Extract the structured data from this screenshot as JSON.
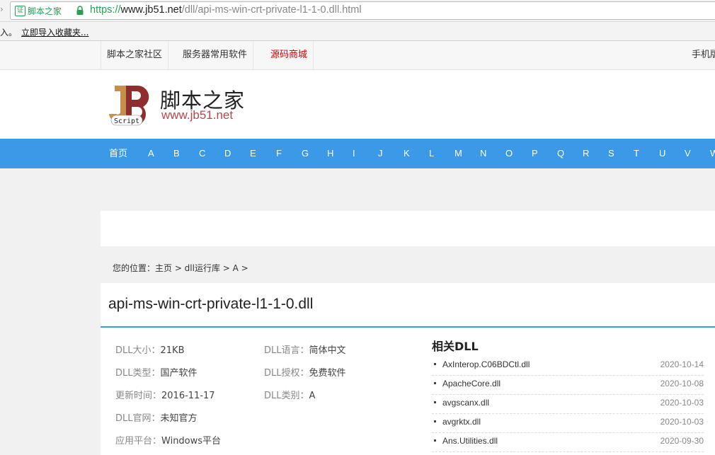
{
  "browser": {
    "cert_label": "脚本之家",
    "cert_icon_text": "证",
    "url_proto": "https://",
    "url_host": "www.jb51.net",
    "url_path": "/dll/api-ms-win-crt-private-l1-1-0.dll.html",
    "bookmarks_cut": "入。",
    "bookmarks_import": "立即导入收藏夹..."
  },
  "topnav": {
    "items": [
      "脚本之家社区",
      "服务器常用软件",
      "源码商城"
    ],
    "highlight_color": "#d40000",
    "right_cut": "手机版"
  },
  "logo": {
    "mark_letters": "JB",
    "mark_sub": "Script",
    "name": "脚本之家",
    "url": "www.jb51.net"
  },
  "alphabar": {
    "color": "#3b99e8",
    "home": "首页",
    "letters": [
      "A",
      "B",
      "C",
      "D",
      "E",
      "F",
      "G",
      "H",
      "I",
      "J",
      "K",
      "L",
      "M",
      "N",
      "O",
      "P",
      "Q",
      "R",
      "S",
      "T",
      "U",
      "V",
      "W"
    ]
  },
  "breadcrumb": "您的位置：主页 > dll运行库 > A >",
  "dll": {
    "title": "api-ms-win-crt-private-l1-1-0.dll",
    "left": [
      {
        "k": "DLL大小：",
        "v": "21KB"
      },
      {
        "k": "DLL类型：",
        "v": "国产软件"
      },
      {
        "k": "更新时间：",
        "v": "2016-11-17"
      },
      {
        "k": "DLL官网：",
        "v": "未知官方"
      },
      {
        "k": "应用平台：",
        "v": "Windows平台"
      }
    ],
    "right": [
      {
        "k": "DLL语言：",
        "v": "简体中文"
      },
      {
        "k": "DLL授权：",
        "v": "免费软件"
      },
      {
        "k": "DLL类别：",
        "v": "A"
      }
    ]
  },
  "related": {
    "heading": "相关DLL",
    "items": [
      {
        "name": "AxInterop.C06BDCtl.dll",
        "date": "2020-10-14"
      },
      {
        "name": "ApacheCore.dll",
        "date": "2020-10-08"
      },
      {
        "name": "avgscanx.dll",
        "date": "2020-10-03"
      },
      {
        "name": "avgrktx.dll",
        "date": "2020-10-03"
      },
      {
        "name": "Ans.Utilities.dll",
        "date": "2020-09-30"
      }
    ]
  }
}
